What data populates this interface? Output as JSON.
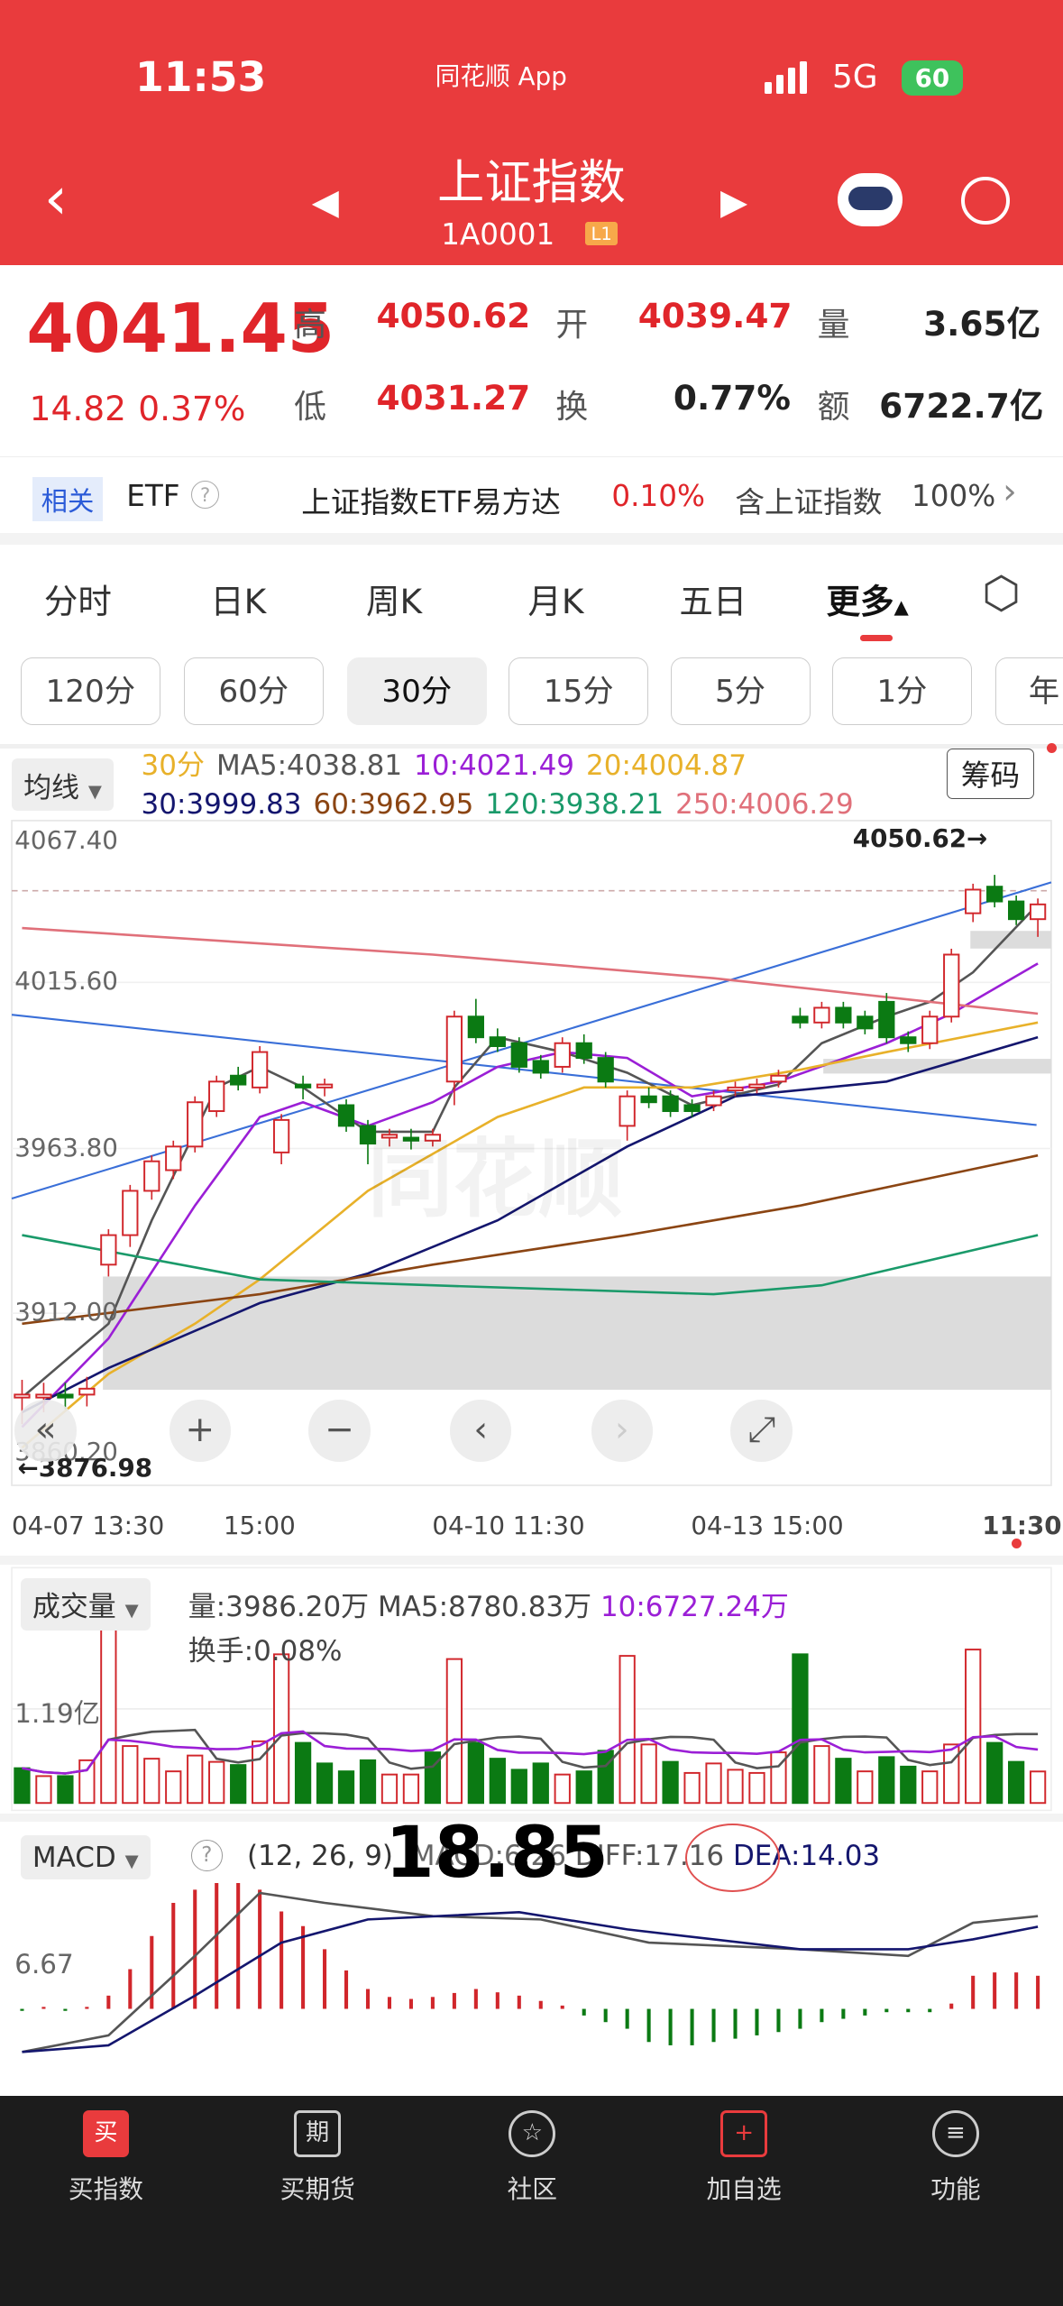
{
  "status": {
    "time": "11:53",
    "app": "同花顺 App",
    "network": "5G",
    "battery": "60"
  },
  "header": {
    "title": "上证指数",
    "code": "1A0001",
    "badge": "L1"
  },
  "quote": {
    "price": "4041.45",
    "change": "14.82",
    "pct": "0.37%",
    "high_l": "高",
    "high": "4050.62",
    "open_l": "开",
    "open": "4039.47",
    "vol_l": "量",
    "vol": "3.65亿",
    "low_l": "低",
    "low": "4031.27",
    "turn_l": "换",
    "turn": "0.77%",
    "amt_l": "额",
    "amt": "6722.7亿"
  },
  "etf": {
    "tag": "相关",
    "label": "ETF",
    "name": "上证指数ETF易方达",
    "pct": "0.10%",
    "contain": "含上证指数",
    "weight": "100%"
  },
  "tabs": [
    "分时",
    "日K",
    "周K",
    "月K",
    "五日",
    "更多"
  ],
  "periods": [
    "120分",
    "60分",
    "30分",
    "15分",
    "5分",
    "1分",
    "年"
  ],
  "ma_legend": {
    "selector": "均线",
    "period": "30分",
    "ma5": "MA5:4038.81",
    "ma10": "10:4021.49",
    "ma20": "20:4004.87",
    "ma30": "30:3999.83",
    "ma60": "60:3962.95",
    "ma120": "120:3938.21",
    "ma250": "250:4006.29",
    "chip": "筹码"
  },
  "colors": {
    "up": "#d1262b",
    "down": "#0b7a13",
    "ma5": "#555555",
    "ma10": "#9b1fd6",
    "ma20": "#e8b12a",
    "ma30": "#14166e",
    "ma60": "#8b4513",
    "ma120": "#1a9a6a",
    "ma250": "#e0707a",
    "trend": "#3a6fd8"
  },
  "kline": {
    "yticks": [
      "4067.40",
      "4015.60",
      "3963.80",
      "3912.00",
      "3860.20"
    ],
    "xticks": [
      "04-07 13:30",
      "15:00",
      "04-10 11:30",
      "04-13 15:00",
      "11:30"
    ],
    "high_mark": "4050.62→",
    "low_mark": "←3876.98",
    "watermark": "同花顺"
  },
  "controls": [
    "«",
    "+",
    "−",
    "‹",
    "›",
    "⤢"
  ],
  "volume": {
    "selector": "成交量",
    "vol": "量:3986.20万",
    "ma5": "MA5:8780.83万",
    "ma10": "10:6727.24万",
    "turnover": "换手:0.08%",
    "ytick": "1.19亿"
  },
  "macd": {
    "selector": "MACD",
    "help": "?",
    "params": "(12, 26, 9)",
    "macd": "MACD:6.26",
    "diff": "DIFF:17.16",
    "dea": "DEA:14.03",
    "ytick": "6.67",
    "overlay": "18.85"
  },
  "nav": [
    {
      "icon": "买",
      "label": "买指数"
    },
    {
      "icon": "期",
      "label": "买期货"
    },
    {
      "icon": "☆",
      "label": "社区"
    },
    {
      "icon": "+",
      "label": "加自选"
    },
    {
      "icon": "≡",
      "label": "功能"
    }
  ],
  "chart_data": {
    "type": "candlestick",
    "price_range": [
      3860.2,
      4067.4
    ],
    "candles": [
      [
        3879,
        3885,
        3870,
        3880
      ],
      [
        3879,
        3884,
        3874,
        3880
      ],
      [
        3880,
        3884,
        3875,
        3879
      ],
      [
        3880,
        3886,
        3876,
        3882
      ],
      [
        3924,
        3936,
        3920,
        3934
      ],
      [
        3934,
        3951,
        3930,
        3949
      ],
      [
        3949,
        3961,
        3946,
        3959
      ],
      [
        3956,
        3966,
        3953,
        3964
      ],
      [
        3964,
        3981,
        3962,
        3979
      ],
      [
        3976,
        3988,
        3974,
        3986
      ],
      [
        3988,
        3991,
        3983,
        3985
      ],
      [
        3984,
        3998,
        3982,
        3996
      ],
      [
        3962,
        3975,
        3958,
        3973
      ],
      [
        3985,
        3988,
        3980,
        3984
      ],
      [
        3984,
        3987,
        3981,
        3985
      ],
      [
        3978,
        3980,
        3969,
        3971
      ],
      [
        3971,
        3973,
        3958,
        3965
      ],
      [
        3967,
        3970,
        3964,
        3968
      ],
      [
        3967,
        3970,
        3963,
        3966
      ],
      [
        3966,
        3970,
        3964,
        3968
      ],
      [
        3986,
        4010,
        3978,
        4008
      ],
      [
        4008,
        4014,
        3999,
        4001
      ],
      [
        4001,
        4004,
        3996,
        3998
      ],
      [
        3999,
        4001,
        3989,
        3991
      ],
      [
        3993,
        3995,
        3987,
        3989
      ],
      [
        3991,
        4001,
        3989,
        3999
      ],
      [
        3999,
        4002,
        3992,
        3994
      ],
      [
        3994,
        3996,
        3984,
        3986
      ],
      [
        3971,
        3983,
        3966,
        3981
      ],
      [
        3981,
        3984,
        3977,
        3979
      ],
      [
        3981,
        3983,
        3974,
        3976
      ],
      [
        3978,
        3980,
        3974,
        3976
      ],
      [
        3978,
        3983,
        3976,
        3981
      ],
      [
        3983,
        3986,
        3981,
        3984
      ],
      [
        3984,
        3987,
        3982,
        3985
      ],
      [
        3986,
        3990,
        3984,
        3988
      ],
      [
        4008,
        4011,
        4004,
        4006
      ],
      [
        4006,
        4013,
        4004,
        4011
      ],
      [
        4011,
        4013,
        4004,
        4006
      ],
      [
        4008,
        4010,
        4002,
        4004
      ],
      [
        4013,
        4016,
        3999,
        4001
      ],
      [
        4001,
        4003,
        3996,
        3999
      ],
      [
        3999,
        4010,
        3997,
        4008
      ],
      [
        4008,
        4031,
        4006,
        4029
      ],
      [
        4043,
        4053,
        4040,
        4051
      ],
      [
        4052,
        4056,
        4045,
        4047
      ],
      [
        4047,
        4049,
        4039,
        4041
      ],
      [
        4041,
        4048,
        4035,
        4046
      ]
    ],
    "ma": {
      "ma5": [
        [
          0,
          3879
        ],
        [
          4,
          3904
        ],
        [
          6,
          3939
        ],
        [
          9,
          3984
        ],
        [
          11,
          3991
        ],
        [
          13,
          3984
        ],
        [
          16,
          3969
        ],
        [
          19,
          3969
        ],
        [
          20,
          3984
        ],
        [
          22,
          4001
        ],
        [
          25,
          3996
        ],
        [
          28,
          3989
        ],
        [
          31,
          3978
        ],
        [
          35,
          3985
        ],
        [
          37,
          3999
        ],
        [
          40,
          4008
        ],
        [
          42,
          4013
        ],
        [
          44,
          4023
        ],
        [
          47,
          4046
        ]
      ],
      "ma10": [
        [
          0,
          3869
        ],
        [
          4,
          3899
        ],
        [
          8,
          3944
        ],
        [
          11,
          3974
        ],
        [
          13,
          3979
        ],
        [
          16,
          3971
        ],
        [
          19,
          3979
        ],
        [
          22,
          3991
        ],
        [
          25,
          3996
        ],
        [
          28,
          3994
        ],
        [
          31,
          3981
        ],
        [
          35,
          3986
        ],
        [
          40,
          3999
        ],
        [
          43,
          4009
        ],
        [
          47,
          4026
        ]
      ],
      "ma20": [
        [
          0,
          3862
        ],
        [
          4,
          3887
        ],
        [
          8,
          3904
        ],
        [
          11,
          3919
        ],
        [
          16,
          3949
        ],
        [
          22,
          3974
        ],
        [
          26,
          3984
        ],
        [
          31,
          3984
        ],
        [
          36,
          3990
        ],
        [
          40,
          3996
        ],
        [
          47,
          4006
        ]
      ],
      "ma30": [
        [
          0,
          3874
        ],
        [
          4,
          3889
        ],
        [
          11,
          3911
        ],
        [
          16,
          3921
        ],
        [
          22,
          3939
        ],
        [
          28,
          3964
        ],
        [
          33,
          3981
        ],
        [
          40,
          3986
        ],
        [
          47,
          4001
        ]
      ],
      "ma60": [
        [
          0,
          3904
        ],
        [
          11,
          3914
        ],
        [
          19,
          3924
        ],
        [
          28,
          3934
        ],
        [
          36,
          3944
        ],
        [
          47,
          3961
        ]
      ],
      "ma120": [
        [
          0,
          3934
        ],
        [
          11,
          3919
        ],
        [
          19,
          3917
        ],
        [
          32,
          3914
        ],
        [
          37,
          3917
        ],
        [
          47,
          3934
        ]
      ],
      "ma250": [
        [
          0,
          4038
        ],
        [
          19,
          4029
        ],
        [
          32,
          4021
        ],
        [
          47,
          4009
        ]
      ]
    },
    "volume_wan": [
      4400,
      3400,
      3400,
      5400,
      23400,
      7200,
      5600,
      4000,
      6000,
      5200,
      4800,
      7800,
      18800,
      7600,
      5000,
      4000,
      5400,
      3600,
      3600,
      6400,
      18200,
      7600,
      5600,
      4200,
      5000,
      3600,
      4000,
      6600,
      18600,
      7400,
      5200,
      3800,
      5000,
      4200,
      3800,
      6400,
      18800,
      7200,
      5600,
      4000,
      5800,
      4600,
      4000,
      7400,
      19400,
      7600,
      5200,
      3986
    ],
    "volume_up": [
      0,
      1,
      0,
      1,
      1,
      1,
      1,
      1,
      1,
      1,
      0,
      1,
      1,
      0,
      0,
      0,
      0,
      1,
      1,
      0,
      1,
      0,
      0,
      0,
      0,
      1,
      0,
      0,
      1,
      1,
      0,
      1,
      1,
      1,
      1,
      1,
      0,
      1,
      0,
      1,
      0,
      0,
      1,
      1,
      1,
      0,
      0,
      1
    ],
    "macd_hist": [
      -0.3,
      0.3,
      -0.3,
      0.3,
      2,
      6,
      11,
      16,
      18,
      19,
      19,
      18,
      14.7,
      12.5,
      9,
      5.8,
      3,
      1.8,
      1.5,
      1.8,
      2.4,
      3,
      2.5,
      2,
      1.2,
      0.5,
      -1,
      -2,
      -3,
      -5,
      -5.5,
      -5.5,
      -5,
      -4.5,
      -4,
      -3.5,
      -3,
      -2,
      -1.5,
      -1,
      -0.5,
      -0.5,
      -0.5,
      0.8,
      5,
      5.5,
      5.5,
      5
    ],
    "diff": [
      [
        0,
        -6.5
      ],
      [
        4,
        -4
      ],
      [
        8,
        8
      ],
      [
        11,
        17.5
      ],
      [
        14,
        16
      ],
      [
        19,
        14
      ],
      [
        24,
        13.5
      ],
      [
        29,
        10
      ],
      [
        36,
        9
      ],
      [
        41,
        8
      ],
      [
        44,
        13
      ],
      [
        47,
        14
      ]
    ],
    "dea": [
      [
        0,
        -6.5
      ],
      [
        4,
        -5.5
      ],
      [
        8,
        2
      ],
      [
        12,
        10
      ],
      [
        16,
        13.5
      ],
      [
        23,
        14.6
      ],
      [
        28,
        12
      ],
      [
        36,
        9
      ],
      [
        41,
        9
      ],
      [
        44,
        10.5
      ],
      [
        47,
        12.4
      ]
    ]
  }
}
